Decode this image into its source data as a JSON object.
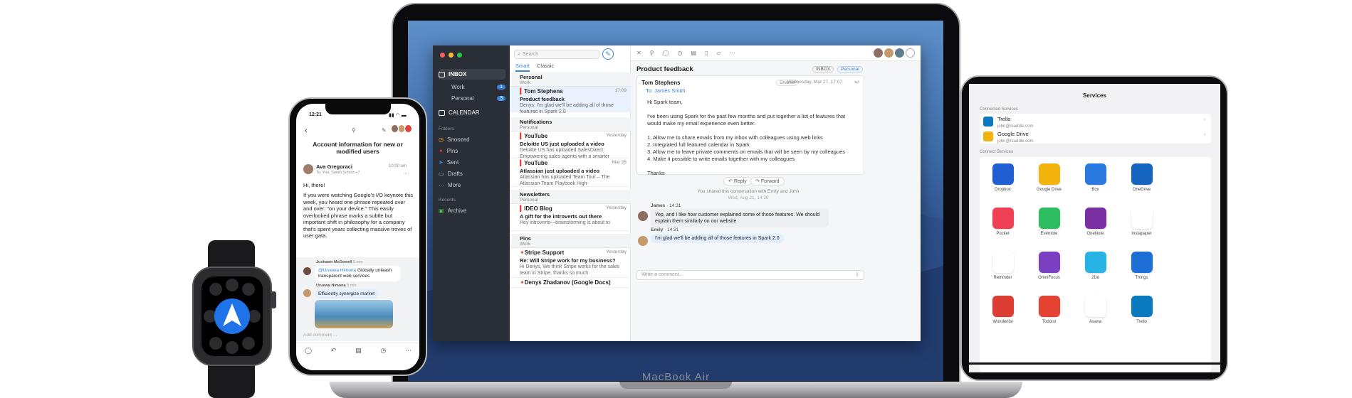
{
  "colors": {
    "accent": "#3b82d9",
    "sidebar": "#2a2e36",
    "flag": "#e0443e"
  },
  "macbook": {
    "label": "MacBook Air",
    "sidebar": {
      "inbox": "INBOX",
      "work": "Work",
      "work_count": "1",
      "personal": "Personal",
      "personal_count": "3",
      "calendar": "CALENDAR",
      "folders_header": "Folders",
      "snoozed": "Snoozed",
      "pins": "Pins",
      "sent": "Sent",
      "drafts": "Drafts",
      "more": "More",
      "recents_header": "Recents",
      "archive": "Archive"
    },
    "list": {
      "search_placeholder": "Search",
      "tab_smart": "Smart",
      "tab_classic": "Classic",
      "sections": [
        {
          "title": "Personal",
          "sub": "Work"
        },
        {
          "title": "Notifications",
          "sub": "Personal"
        },
        {
          "title": "Newsletters",
          "sub": "Personal"
        },
        {
          "title": "Pins",
          "sub": "Work"
        }
      ],
      "items": [
        {
          "from": "Tom Stephens",
          "time": "17:09",
          "subject": "Product feedback",
          "preview": "Denys: I'm glad we'll be adding all of those features in Spark 2.0"
        },
        {
          "from": "YouTube",
          "time": "Yesterday",
          "subject": "Deloitte US just uploaded a video",
          "preview": "Deloitte US has uploaded SalesDirect: Empowering sales agents with a smarter"
        },
        {
          "from": "YouTube",
          "time": "Mar 26",
          "subject": "Atlassian just uploaded a video",
          "preview": "Atlassian has uploaded Team Tour – The Atlassian Team Playbook High-"
        },
        {
          "from": "IDEO Blog",
          "time": "Yesterday",
          "subject": "A gift for the introverts out there",
          "preview": "Hey introverts—brainstorming is about to"
        },
        {
          "from": "Stripe Support",
          "time": "Yesterday",
          "subject": "Re: Will Stripe work for my business?",
          "preview": "Hi Denys, We think Stripe works for the sales team in Stripe, thanks so much",
          "count": "3"
        },
        {
          "from": "Denys Zhadanov (Google Docs)",
          "time": "",
          "subject": "",
          "preview": ""
        }
      ]
    },
    "reader": {
      "title": "Product feedback",
      "inbox_tag": "INBOX",
      "personal_tag": "Personal",
      "from": "Tom Stephens",
      "shared": "Shared",
      "date": "Wednesday, Mar 27, 17:07",
      "to": "To: James Smith",
      "body": [
        "Hi Spark team,",
        "I've been using Spark for the past few months and put together a list of features that would make my email experience even better.",
        "1. Allow me to share emails from my inbox with colleagues using web links",
        "2. Integrated full featured calendar in Spark",
        "3. Allow me to leave private comments on emails that will be seen by my colleagues",
        "4. Make it possible to write emails together with my colleagues",
        "Thanks"
      ],
      "reply": "Reply",
      "forward": "Forward",
      "shared_note": "You shared this conversation with Emily and John",
      "shared_date": "Wed, Aug 21, 14:30",
      "comments": [
        {
          "name": "James",
          "time": "· 14:31",
          "text": "Yep, and I like how customer explained some of those features. We should explain them similarly on our website"
        },
        {
          "name": "Emily",
          "time": "· 14:31",
          "text": "I'm glad we'll be adding all of those features in Spark 2.0"
        }
      ],
      "comment_placeholder": "Write a comment..."
    }
  },
  "iphone": {
    "time": "12:21",
    "title": "Account information for new or modified users",
    "sender": "Ava Gregoraci",
    "sender_time": "10:00 am",
    "sender_to": "To: You, Sarah Scholz +7",
    "body1": "Hi, there!",
    "body2": "If you were watching Google's I/O keynote this week, you heard one phrase repeated over and over: \"on your device.\" This easily overlooked phrase marks a subtle but important shift in philosophy for a company that's spent years collecting massive troves of user gata.",
    "c1_name": "Jushawn McDowell",
    "c1_time": "5 min",
    "c1_mention": "@Uruewa Himona",
    "c1_text": " Globally unleash transparent web services",
    "c2_name": "Uruewa Himona",
    "c2_time": "5 min",
    "c2_text": "Efficiently synergize market",
    "comment_placeholder": "Add comment ..."
  },
  "ipad": {
    "title": "Services",
    "connected_header": "Connected Services",
    "connected": [
      {
        "name": "Trello",
        "email": "john@readdle.com"
      },
      {
        "name": "Google Drive",
        "email": "john@readdle.com"
      }
    ],
    "connect_header": "Connect Services",
    "services": [
      {
        "name": "Dropbox",
        "color": "#1f5fd1"
      },
      {
        "name": "Google Drive",
        "color": "#f2b40c"
      },
      {
        "name": "Box",
        "color": "#2a7ae2"
      },
      {
        "name": "OneDrive",
        "color": "#1565c0"
      },
      {
        "name": "",
        "color": ""
      },
      {
        "name": "Pocket",
        "color": "#ef4056"
      },
      {
        "name": "Evernote",
        "color": "#2dbe60"
      },
      {
        "name": "OneNote",
        "color": "#7a2fa2"
      },
      {
        "name": "Instapaper",
        "color": "#ffffff"
      },
      {
        "name": "",
        "color": ""
      },
      {
        "name": "Reminder",
        "color": "#ffffff"
      },
      {
        "name": "OmniFocus",
        "color": "#7b3fc2"
      },
      {
        "name": "2Do",
        "color": "#27b3e6"
      },
      {
        "name": "Things",
        "color": "#1b6fd6"
      },
      {
        "name": "",
        "color": ""
      },
      {
        "name": "Wunderlist",
        "color": "#dc3e33"
      },
      {
        "name": "Todoist",
        "color": "#e44332"
      },
      {
        "name": "Asana",
        "color": "#ffffff"
      },
      {
        "name": "Trello",
        "color": "#0b79bf"
      },
      {
        "name": "",
        "color": ""
      }
    ]
  }
}
